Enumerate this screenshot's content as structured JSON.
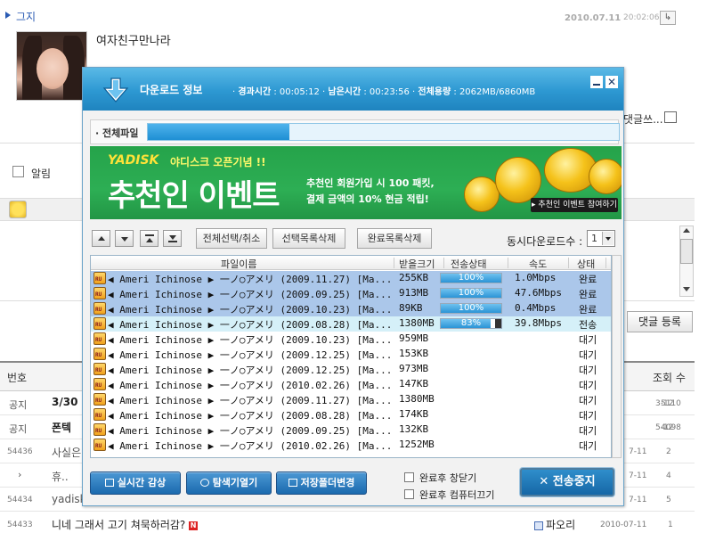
{
  "post": {
    "author": "그지",
    "date": "2010.07.11",
    "time": "20:02:06",
    "content": "여자친구만나라",
    "comment_link": "댓글쓰..."
  },
  "comment_form": {
    "alert_label": "알림",
    "submit_label": "댓글 등록"
  },
  "board": {
    "col_number": "번호",
    "col_views": "조회 수",
    "rows": [
      {
        "num": "공지",
        "title": "3/30",
        "date": "3-12",
        "views": "5110"
      },
      {
        "num": "공지",
        "title": "폰텍",
        "date": "5-12",
        "views": "4098"
      },
      {
        "num": "54436",
        "title": "사실은",
        "date": "7-11",
        "views": "2"
      },
      {
        "num": "›",
        "title": "휴..",
        "date": "7-11",
        "views": "4"
      },
      {
        "num": "54434",
        "title": "yadisk",
        "date": "7-11",
        "views": "5"
      },
      {
        "num": "54433",
        "title": "니네 그래서 고기 쳐묵하러감?",
        "new_badge": "N",
        "author": "파오리",
        "date": "2010-07-11",
        "views": "1"
      }
    ]
  },
  "dialog": {
    "title": "다운로드 정보",
    "elapsed_label": "경과시간",
    "elapsed": "00:05:12",
    "remaining_label": "남은시간",
    "remaining": "00:23:56",
    "total_size_label": "전체용량",
    "total_size": "2062MB/6860MB",
    "total_file_label": "· 전체파일",
    "total_progress": 0.3,
    "ad": {
      "logo": "YADISK",
      "logo_sub": "야디스크 오픈기념 !!",
      "headline": "추천인 이벤트",
      "desc1": "추천인 회원가입 시 100 패킷,",
      "desc2": "결제 금액의 10% 현금 적립!",
      "button": "▸ 추천인 이벤트 참여하기"
    },
    "controls": {
      "select_all": "전체선택/취소",
      "delete_selected": "선택목록삭제",
      "delete_done": "완료목록삭제",
      "concurrent_label": "동시다운로드수 :",
      "concurrent_value": "1"
    },
    "columns": {
      "filename": "파일이름",
      "received": "받을크기",
      "transfer": "전송상태",
      "speed": "속도",
      "status": "상태"
    },
    "files": [
      {
        "name": "◀ Ameri Ichinose ▶ 一ノ○アメリ (2009.11.27) [Ma...",
        "size": "255KB",
        "progress": 1.0,
        "progress_text": "100%",
        "speed": "1.0Mbps",
        "status": "완료",
        "state": "done"
      },
      {
        "name": "◀ Ameri Ichinose ▶ 一ノ○アメリ (2009.09.25) [Ma...",
        "size": "913MB",
        "progress": 1.0,
        "progress_text": "100%",
        "speed": "47.6Mbps",
        "status": "완료",
        "state": "done"
      },
      {
        "name": "◀ Ameri Ichinose ▶ 一ノ○アメリ (2009.10.23) [Ma...",
        "size": "89KB",
        "progress": 1.0,
        "progress_text": "100%",
        "speed": "0.4Mbps",
        "status": "완료",
        "state": "done"
      },
      {
        "name": "◀ Ameri Ichinose ▶ 一ノ○アメリ (2009.08.28) [Ma...",
        "size": "1380MB",
        "progress": 0.83,
        "progress_text": "83%",
        "speed": "39.8Mbps",
        "status": "전송",
        "state": "active"
      },
      {
        "name": "◀ Ameri Ichinose ▶ 一ノ○アメリ (2009.10.23) [Ma...",
        "size": "959MB",
        "progress": 0,
        "progress_text": "",
        "speed": "",
        "status": "대기",
        "state": "wait"
      },
      {
        "name": "◀ Ameri Ichinose ▶ 一ノ○アメリ (2009.12.25) [Ma...",
        "size": "153KB",
        "progress": 0,
        "progress_text": "",
        "speed": "",
        "status": "대기",
        "state": "wait"
      },
      {
        "name": "◀ Ameri Ichinose ▶ 一ノ○アメリ (2009.12.25) [Ma...",
        "size": "973MB",
        "progress": 0,
        "progress_text": "",
        "speed": "",
        "status": "대기",
        "state": "wait"
      },
      {
        "name": "◀ Ameri Ichinose ▶ 一ノ○アメリ (2010.02.26) [Ma...",
        "size": "147KB",
        "progress": 0,
        "progress_text": "",
        "speed": "",
        "status": "대기",
        "state": "wait"
      },
      {
        "name": "◀ Ameri Ichinose ▶ 一ノ○アメリ (2009.11.27) [Ma...",
        "size": "1380MB",
        "progress": 0,
        "progress_text": "",
        "speed": "",
        "status": "대기",
        "state": "wait"
      },
      {
        "name": "◀ Ameri Ichinose ▶ 一ノ○アメリ (2009.08.28) [Ma...",
        "size": "174KB",
        "progress": 0,
        "progress_text": "",
        "speed": "",
        "status": "대기",
        "state": "wait"
      },
      {
        "name": "◀ Ameri Ichinose ▶ 一ノ○アメリ (2009.09.25) [Ma...",
        "size": "132KB",
        "progress": 0,
        "progress_text": "",
        "speed": "",
        "status": "대기",
        "state": "wait"
      },
      {
        "name": "◀ Ameri Ichinose ▶ 一ノ○アメリ (2010.02.26) [Ma...",
        "size": "1252MB",
        "progress": 0,
        "progress_text": "",
        "speed": "",
        "status": "대기",
        "state": "wait"
      }
    ],
    "buttons": {
      "realtime": "실시간 감상",
      "explorer": "탐색기열기",
      "change_folder": "저장폴더변경",
      "close_after": "완료후 창닫기",
      "shutdown_after": "완료후 컴퓨터끄기",
      "stop": "전송중지"
    },
    "colors": {
      "title_bar": "#2d98d2",
      "progress": "#2b94d6",
      "selected_row": "#abc7ea",
      "ad_green": "#2dae54"
    }
  }
}
